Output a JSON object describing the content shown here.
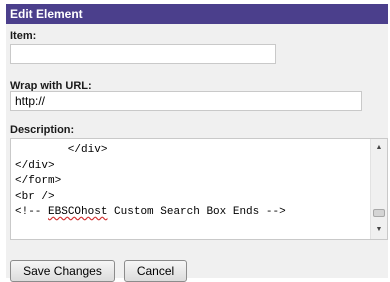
{
  "dialog": {
    "title": "Edit Element",
    "item": {
      "label": "Item:",
      "value": ""
    },
    "url": {
      "label": "Wrap with URL:",
      "value": "http://"
    },
    "description": {
      "label": "Description:",
      "lines": [
        "        </div>",
        "</div>",
        "</form>",
        "<br />"
      ],
      "last_line_prefix": "<!-- ",
      "last_line_misspelled": "EBSCOhost",
      "last_line_suffix": " Custom Search Box Ends -->"
    },
    "buttons": {
      "save": "Save Changes",
      "cancel": "Cancel"
    }
  },
  "colors": {
    "title_bar": "#4b3f8c",
    "panel": "#f0f0f0"
  },
  "icons": {
    "scroll_up": "up-arrow",
    "scroll_down": "down-arrow"
  }
}
